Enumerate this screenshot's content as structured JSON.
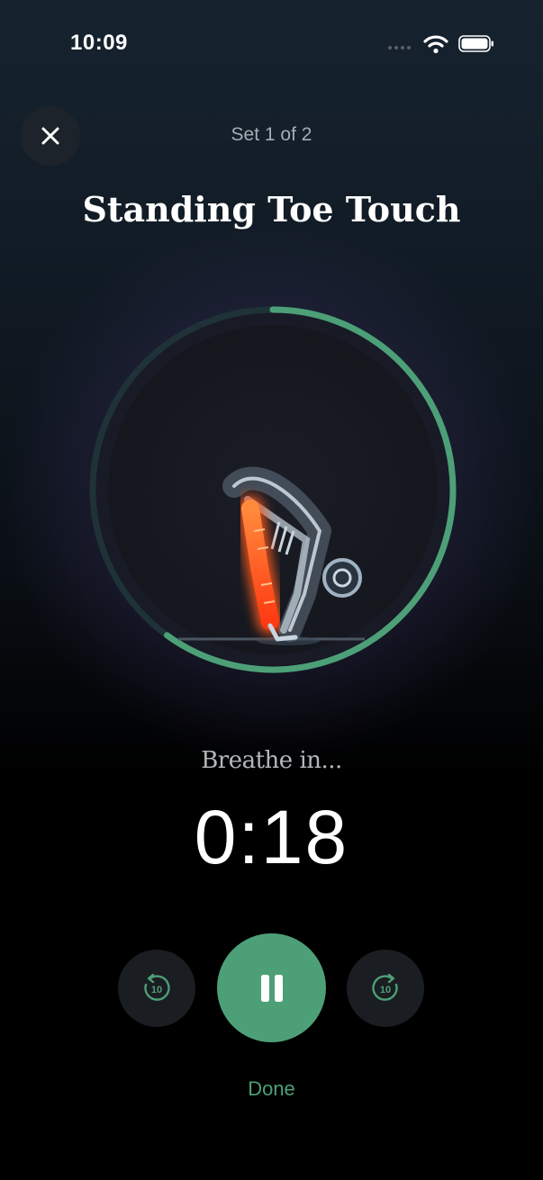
{
  "status_bar": {
    "time": "10:09"
  },
  "header": {
    "set_label": "Set 1 of 2",
    "title": "Standing Toe Touch"
  },
  "breathing": {
    "prompt": "Breathe in..."
  },
  "timer": {
    "value": "0:18",
    "ring_progress": 0.6
  },
  "controls": {
    "rewind_seconds": "10",
    "forward_seconds": "10",
    "done_label": "Done"
  },
  "colors": {
    "accent_green": "#4d9f77",
    "highlight_orange": "#ff5a1f"
  },
  "icons": [
    "close-icon",
    "pause-icon",
    "rewind-10-icon",
    "forward-10-icon",
    "wifi-icon",
    "battery-icon"
  ]
}
